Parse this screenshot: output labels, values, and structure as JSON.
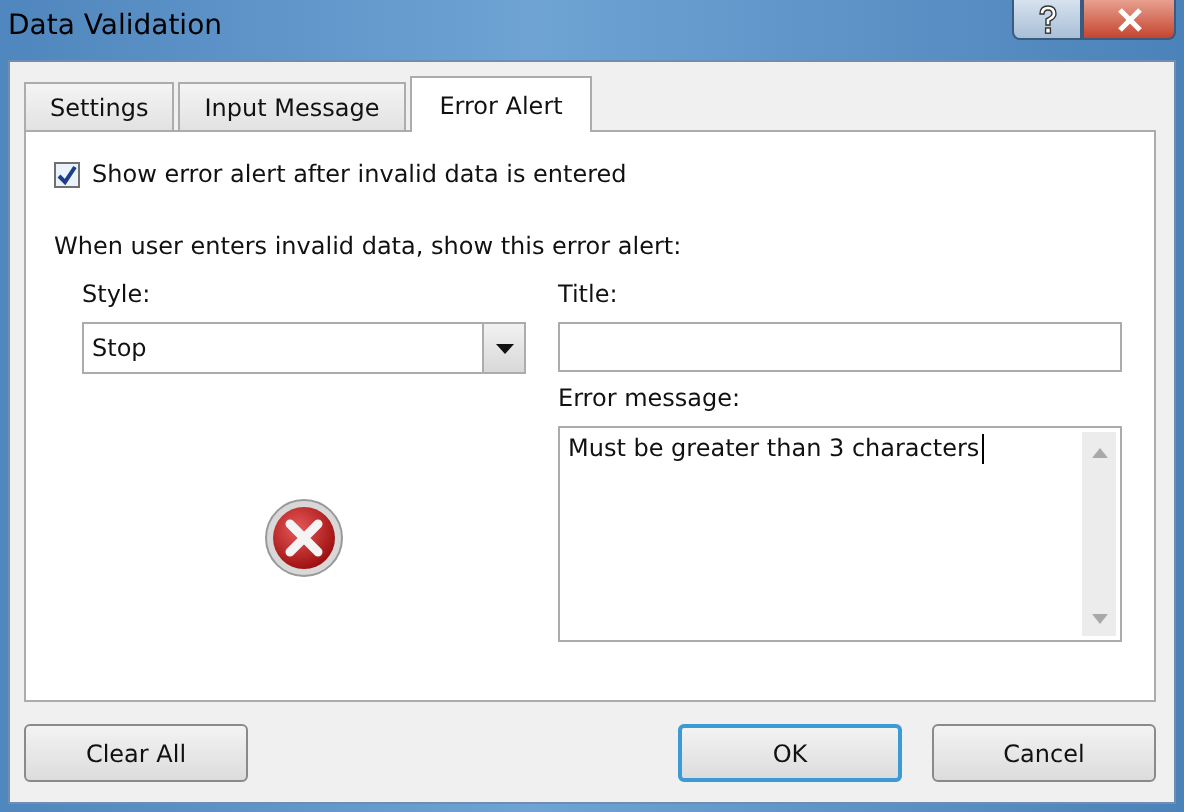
{
  "window": {
    "title": "Data Validation"
  },
  "tabs": [
    {
      "label": "Settings",
      "selected": false
    },
    {
      "label": "Input Message",
      "selected": false
    },
    {
      "label": "Error Alert",
      "selected": true
    }
  ],
  "show_error_alert": {
    "label": "Show error alert after invalid data is entered",
    "checked": true
  },
  "instruction": "When user enters invalid data, show this error alert:",
  "style": {
    "label": "Style:",
    "value": "Stop"
  },
  "title_field": {
    "label": "Title:"
  },
  "error_message": {
    "label": "Error message:",
    "value": "Must be greater than 3 characters"
  },
  "buttons": [
    {
      "label": "Clear All",
      "kind": "secondary"
    },
    {
      "label": "OK",
      "kind": "default"
    },
    {
      "label": "Cancel",
      "kind": "secondary"
    }
  ]
}
